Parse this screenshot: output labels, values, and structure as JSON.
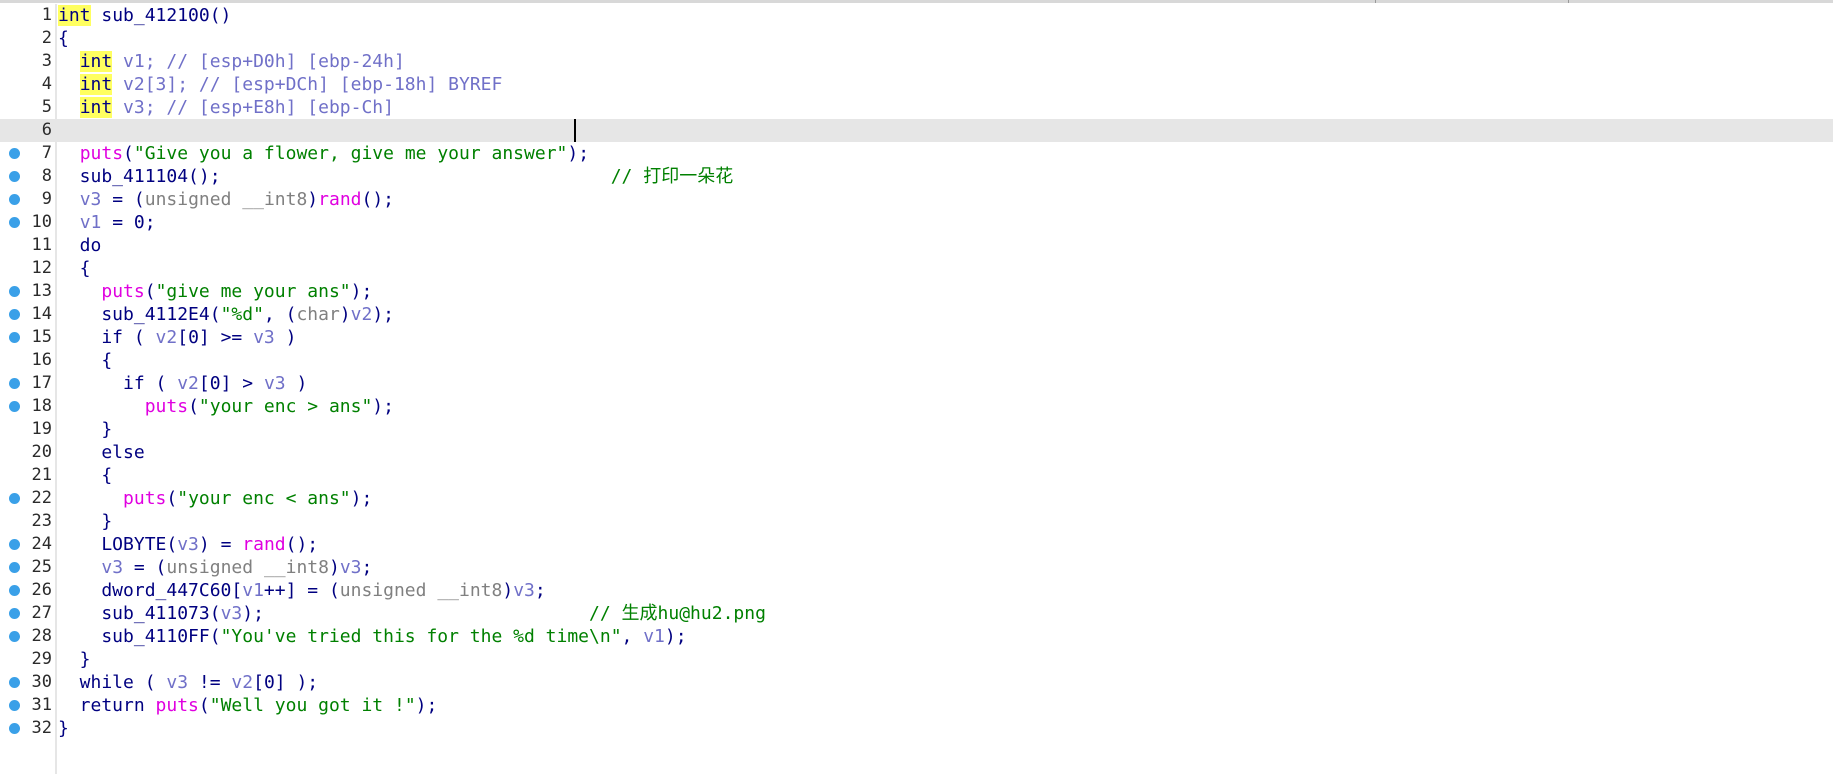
{
  "editor": {
    "cursor_line": 6,
    "lines": [
      {
        "n": "1",
        "bp": false,
        "t": [
          [
            "ty",
            "int"
          ],
          [
            "pu",
            " sub_412100()"
          ]
        ]
      },
      {
        "n": "2",
        "bp": false,
        "t": [
          [
            "pu",
            "{"
          ]
        ]
      },
      {
        "n": "3",
        "bp": false,
        "t": [
          [
            "pu",
            "  "
          ],
          [
            "ty",
            "int"
          ],
          [
            "var",
            " v1; // [esp+D0h] [ebp-24h]"
          ]
        ]
      },
      {
        "n": "4",
        "bp": false,
        "t": [
          [
            "pu",
            "  "
          ],
          [
            "ty",
            "int"
          ],
          [
            "var",
            " v2[3]; // [esp+DCh] [ebp-18h] BYREF"
          ]
        ]
      },
      {
        "n": "5",
        "bp": false,
        "t": [
          [
            "pu",
            "  "
          ],
          [
            "ty",
            "int"
          ],
          [
            "var",
            " v3; // [esp+E8h] [ebp-Ch]"
          ]
        ]
      },
      {
        "n": "6",
        "bp": false,
        "t": []
      },
      {
        "n": "7",
        "bp": true,
        "t": [
          [
            "pu",
            "  "
          ],
          [
            "lib",
            "puts"
          ],
          [
            "pu",
            "("
          ],
          [
            "str",
            "\"Give you a flower, give me your answer\""
          ],
          [
            "pu",
            ");"
          ]
        ]
      },
      {
        "n": "8",
        "bp": true,
        "t": [
          [
            "pu",
            "  sub_411104();                                    "
          ],
          [
            "cm",
            "// 打印一朵花"
          ]
        ]
      },
      {
        "n": "9",
        "bp": true,
        "t": [
          [
            "pu",
            "  "
          ],
          [
            "var",
            "v3"
          ],
          [
            "pu",
            " = ("
          ],
          [
            "cst",
            "unsigned __int8"
          ],
          [
            "pu",
            ")"
          ],
          [
            "lib",
            "rand"
          ],
          [
            "pu",
            "();"
          ]
        ]
      },
      {
        "n": "10",
        "bp": true,
        "t": [
          [
            "pu",
            "  "
          ],
          [
            "var",
            "v1"
          ],
          [
            "pu",
            " = 0;"
          ]
        ]
      },
      {
        "n": "11",
        "bp": false,
        "t": [
          [
            "pu",
            "  do"
          ]
        ]
      },
      {
        "n": "12",
        "bp": false,
        "t": [
          [
            "pu",
            "  {"
          ]
        ]
      },
      {
        "n": "13",
        "bp": true,
        "t": [
          [
            "pu",
            "    "
          ],
          [
            "lib",
            "puts"
          ],
          [
            "pu",
            "("
          ],
          [
            "str",
            "\"give me your ans\""
          ],
          [
            "pu",
            ");"
          ]
        ]
      },
      {
        "n": "14",
        "bp": true,
        "t": [
          [
            "pu",
            "    sub_4112E4("
          ],
          [
            "str",
            "\"%d\""
          ],
          [
            "pu",
            ", ("
          ],
          [
            "cst",
            "char"
          ],
          [
            "pu",
            ")"
          ],
          [
            "var",
            "v2"
          ],
          [
            "pu",
            ");"
          ]
        ]
      },
      {
        "n": "15",
        "bp": true,
        "t": [
          [
            "pu",
            "    if ( "
          ],
          [
            "var",
            "v2"
          ],
          [
            "pu",
            "[0] >= "
          ],
          [
            "var",
            "v3"
          ],
          [
            "pu",
            " )"
          ]
        ]
      },
      {
        "n": "16",
        "bp": false,
        "t": [
          [
            "pu",
            "    {"
          ]
        ]
      },
      {
        "n": "17",
        "bp": true,
        "t": [
          [
            "pu",
            "      if ( "
          ],
          [
            "var",
            "v2"
          ],
          [
            "pu",
            "[0] > "
          ],
          [
            "var",
            "v3"
          ],
          [
            "pu",
            " )"
          ]
        ]
      },
      {
        "n": "18",
        "bp": true,
        "t": [
          [
            "pu",
            "        "
          ],
          [
            "lib",
            "puts"
          ],
          [
            "pu",
            "("
          ],
          [
            "str",
            "\"your enc > ans\""
          ],
          [
            "pu",
            ");"
          ]
        ]
      },
      {
        "n": "19",
        "bp": false,
        "t": [
          [
            "pu",
            "    }"
          ]
        ]
      },
      {
        "n": "20",
        "bp": false,
        "t": [
          [
            "pu",
            "    else"
          ]
        ]
      },
      {
        "n": "21",
        "bp": false,
        "t": [
          [
            "pu",
            "    {"
          ]
        ]
      },
      {
        "n": "22",
        "bp": true,
        "t": [
          [
            "pu",
            "      "
          ],
          [
            "lib",
            "puts"
          ],
          [
            "pu",
            "("
          ],
          [
            "str",
            "\"your enc < ans\""
          ],
          [
            "pu",
            ");"
          ]
        ]
      },
      {
        "n": "23",
        "bp": false,
        "t": [
          [
            "pu",
            "    }"
          ]
        ]
      },
      {
        "n": "24",
        "bp": true,
        "t": [
          [
            "pu",
            "    LOBYTE("
          ],
          [
            "var",
            "v3"
          ],
          [
            "pu",
            ") = "
          ],
          [
            "lib",
            "rand"
          ],
          [
            "pu",
            "();"
          ]
        ]
      },
      {
        "n": "25",
        "bp": true,
        "t": [
          [
            "pu",
            "    "
          ],
          [
            "var",
            "v3"
          ],
          [
            "pu",
            " = ("
          ],
          [
            "cst",
            "unsigned __int8"
          ],
          [
            "pu",
            ")"
          ],
          [
            "var",
            "v3"
          ],
          [
            "pu",
            ";"
          ]
        ]
      },
      {
        "n": "26",
        "bp": true,
        "t": [
          [
            "pu",
            "    dword_447C60["
          ],
          [
            "var",
            "v1"
          ],
          [
            "pu",
            "++] = ("
          ],
          [
            "cst",
            "unsigned __int8"
          ],
          [
            "pu",
            ")"
          ],
          [
            "var",
            "v3"
          ],
          [
            "pu",
            ";"
          ]
        ]
      },
      {
        "n": "27",
        "bp": true,
        "t": [
          [
            "pu",
            "    sub_411073("
          ],
          [
            "var",
            "v3"
          ],
          [
            "pu",
            ");                              "
          ],
          [
            "cm",
            "// 生成hu@hu2.png"
          ]
        ]
      },
      {
        "n": "28",
        "bp": true,
        "t": [
          [
            "pu",
            "    sub_4110FF("
          ],
          [
            "str",
            "\"You've tried this for the %d time\\n\""
          ],
          [
            "pu",
            ", "
          ],
          [
            "var",
            "v1"
          ],
          [
            "pu",
            ");"
          ]
        ]
      },
      {
        "n": "29",
        "bp": false,
        "t": [
          [
            "pu",
            "  }"
          ]
        ]
      },
      {
        "n": "30",
        "bp": true,
        "t": [
          [
            "pu",
            "  while ( "
          ],
          [
            "var",
            "v3"
          ],
          [
            "pu",
            " != "
          ],
          [
            "var",
            "v2"
          ],
          [
            "pu",
            "[0] );"
          ]
        ]
      },
      {
        "n": "31",
        "bp": true,
        "t": [
          [
            "pu",
            "  return "
          ],
          [
            "lib",
            "puts"
          ],
          [
            "pu",
            "("
          ],
          [
            "str",
            "\"Well you got it !\""
          ],
          [
            "pu",
            ");"
          ]
        ]
      },
      {
        "n": "32",
        "bp": true,
        "t": [
          [
            "pu",
            "}"
          ]
        ]
      }
    ]
  }
}
